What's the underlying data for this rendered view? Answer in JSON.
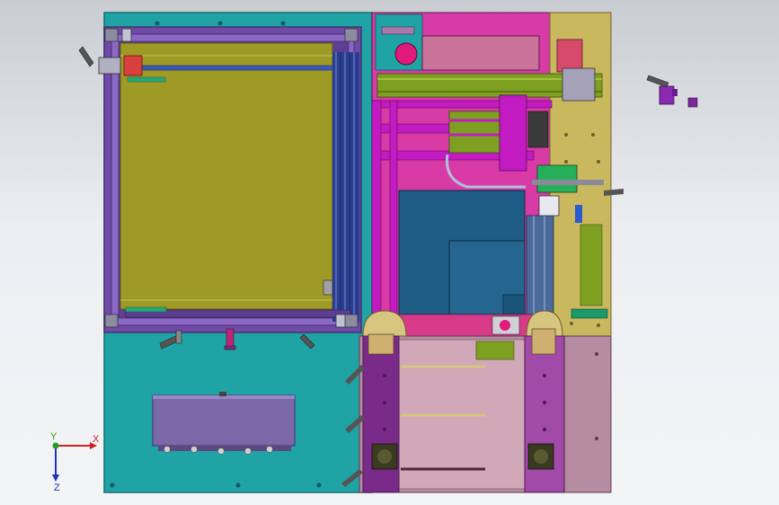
{
  "triad": {
    "x_label": "X",
    "y_label": "Y",
    "z_label": "Z"
  },
  "colors": {
    "panel_teal": "#1fa3a5",
    "frame_purple": "#6f4aa6",
    "window_olive": "#9e9a25",
    "magenta": "#c21bc2",
    "rail_green": "#7ea020",
    "tan": "#c9b85e",
    "pink_block": "#c9739a",
    "blue_block": "#1f5c86",
    "lavender_box": "#7c67a8",
    "mauve_plate": "#b58ca2",
    "dark_purple": "#7a2a88",
    "axis_x": "#d02020",
    "axis_y": "#20a020",
    "axis_z": "#2030c0"
  }
}
